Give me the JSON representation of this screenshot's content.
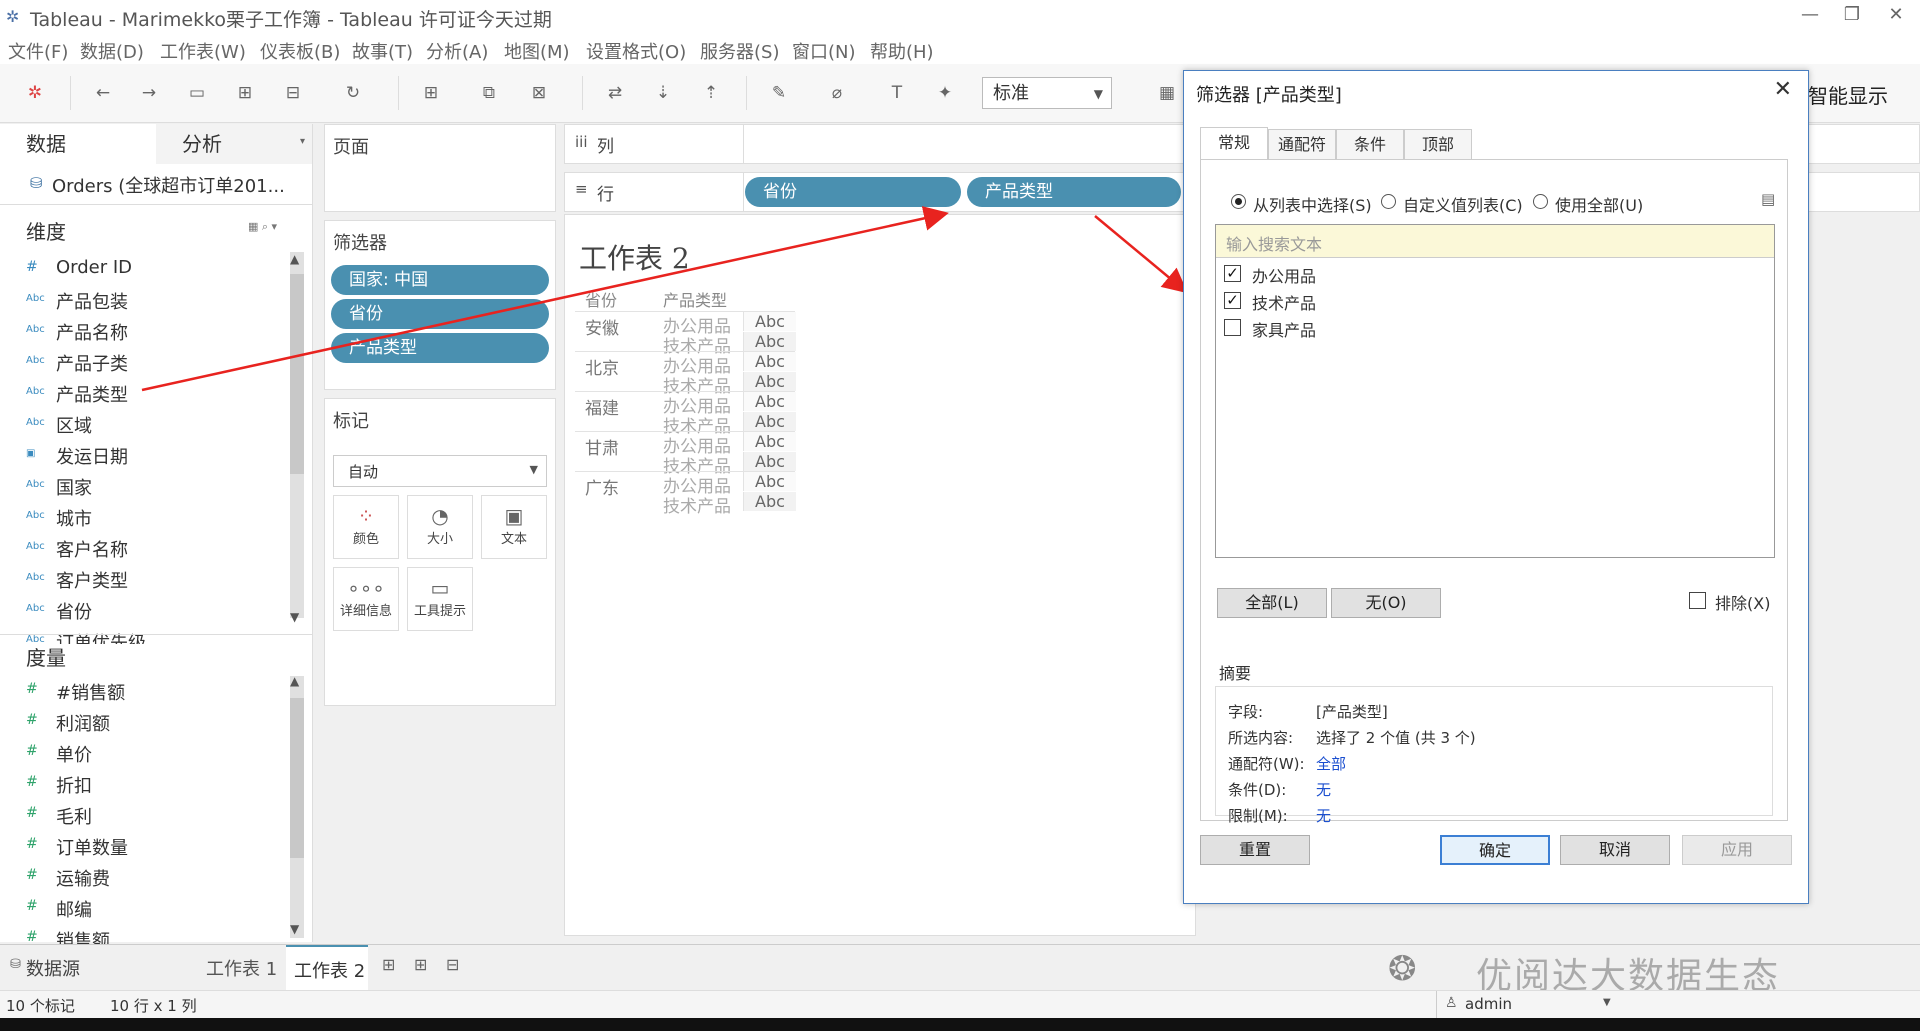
{
  "window": {
    "title": "Tableau - Marimekko栗子工作簿 - Tableau 许可证今天过期"
  },
  "menu": [
    "文件(F)",
    "数据(D)",
    "工作表(W)",
    "仪表板(B)",
    "故事(T)",
    "分析(A)",
    "地图(M)",
    "设置格式(O)",
    "服务器(S)",
    "窗口(N)",
    "帮助(H)"
  ],
  "toolbar": {
    "fit_value": "标准",
    "show_me": "智能显示"
  },
  "left": {
    "tab_data": "数据",
    "tab_analysis": "分析",
    "datasource": "Orders (全球超市订单201...",
    "dimensions_title": "维度",
    "dimensions": [
      {
        "type": "#",
        "name": "Order ID"
      },
      {
        "type": "Abc",
        "name": "产品包装"
      },
      {
        "type": "Abc",
        "name": "产品名称"
      },
      {
        "type": "Abc",
        "name": "产品子类"
      },
      {
        "type": "Abc",
        "name": "产品类型"
      },
      {
        "type": "Abc",
        "name": "区域"
      },
      {
        "type": "date",
        "name": "发运日期"
      },
      {
        "type": "Abc",
        "name": "国家"
      },
      {
        "type": "Abc",
        "name": "城市"
      },
      {
        "type": "Abc",
        "name": "客户名称"
      },
      {
        "type": "Abc",
        "name": "客户类型"
      },
      {
        "type": "Abc",
        "name": "省份"
      },
      {
        "type": "Abc",
        "name": "订单优先级"
      }
    ],
    "measures_title": "度量",
    "measures": [
      "#销售额",
      "利润额",
      "单价",
      "折扣",
      "毛利",
      "订单数量",
      "运输费",
      "邮编",
      "销售额"
    ]
  },
  "shelves": {
    "pages": "页面",
    "filters": "筛选器",
    "filter_pills": [
      "国家: 中国",
      "省份",
      "产品类型"
    ],
    "marks": "标记",
    "mark_type": "自动",
    "mark_buttons": [
      "颜色",
      "大小",
      "文本",
      "详细信息",
      "工具提示"
    ],
    "columns": "列",
    "rows": "行",
    "row_pills": [
      "省份",
      "产品类型"
    ]
  },
  "view": {
    "title": "工作表 2",
    "col_headers": [
      "省份",
      "产品类型"
    ],
    "rows": [
      {
        "province": "安徽",
        "types": [
          "办公用品",
          "技术产品"
        ]
      },
      {
        "province": "北京",
        "types": [
          "办公用品",
          "技术产品"
        ]
      },
      {
        "province": "福建",
        "types": [
          "办公用品",
          "技术产品"
        ]
      },
      {
        "province": "甘肃",
        "types": [
          "办公用品",
          "技术产品"
        ]
      },
      {
        "province": "广东",
        "types": [
          "办公用品",
          "技术产品"
        ]
      }
    ],
    "cell_text": "Abc"
  },
  "dialog": {
    "title": "筛选器 [产品类型]",
    "tabs": [
      "常规",
      "通配符",
      "条件",
      "顶部"
    ],
    "radio_list": "从列表中选择(S)",
    "radio_custom": "自定义值列表(C)",
    "radio_all": "使用全部(U)",
    "search_placeholder": "输入搜索文本",
    "items": [
      {
        "label": "办公用品",
        "checked": true
      },
      {
        "label": "技术产品",
        "checked": true
      },
      {
        "label": "家具产品",
        "checked": false
      }
    ],
    "btn_all": "全部(L)",
    "btn_none": "无(O)",
    "exclude": "排除(X)",
    "summary_title": "摘要",
    "summary": [
      {
        "k": "字段:",
        "v": "[产品类型]",
        "link": false
      },
      {
        "k": "所选内容:",
        "v": "选择了 2 个值 (共 3 个)",
        "link": false
      },
      {
        "k": "通配符(W):",
        "v": "全部",
        "link": true
      },
      {
        "k": "条件(D):",
        "v": "无",
        "link": true
      },
      {
        "k": "限制(M):",
        "v": "无",
        "link": true
      }
    ],
    "btn_reset": "重置",
    "btn_ok": "确定",
    "btn_cancel": "取消",
    "btn_apply": "应用"
  },
  "bottom": {
    "datasource_tab": "数据源",
    "sheets": [
      "工作表 1",
      "工作表 2"
    ],
    "watermark": "优阅达大数据生态"
  },
  "status": {
    "marks": "10 个标记",
    "dims": "10 行 x 1 列",
    "user": "admin"
  },
  "colors": {
    "pill": "#4a90b0",
    "arrow": "#e8231f",
    "link": "#1a4ecf"
  }
}
